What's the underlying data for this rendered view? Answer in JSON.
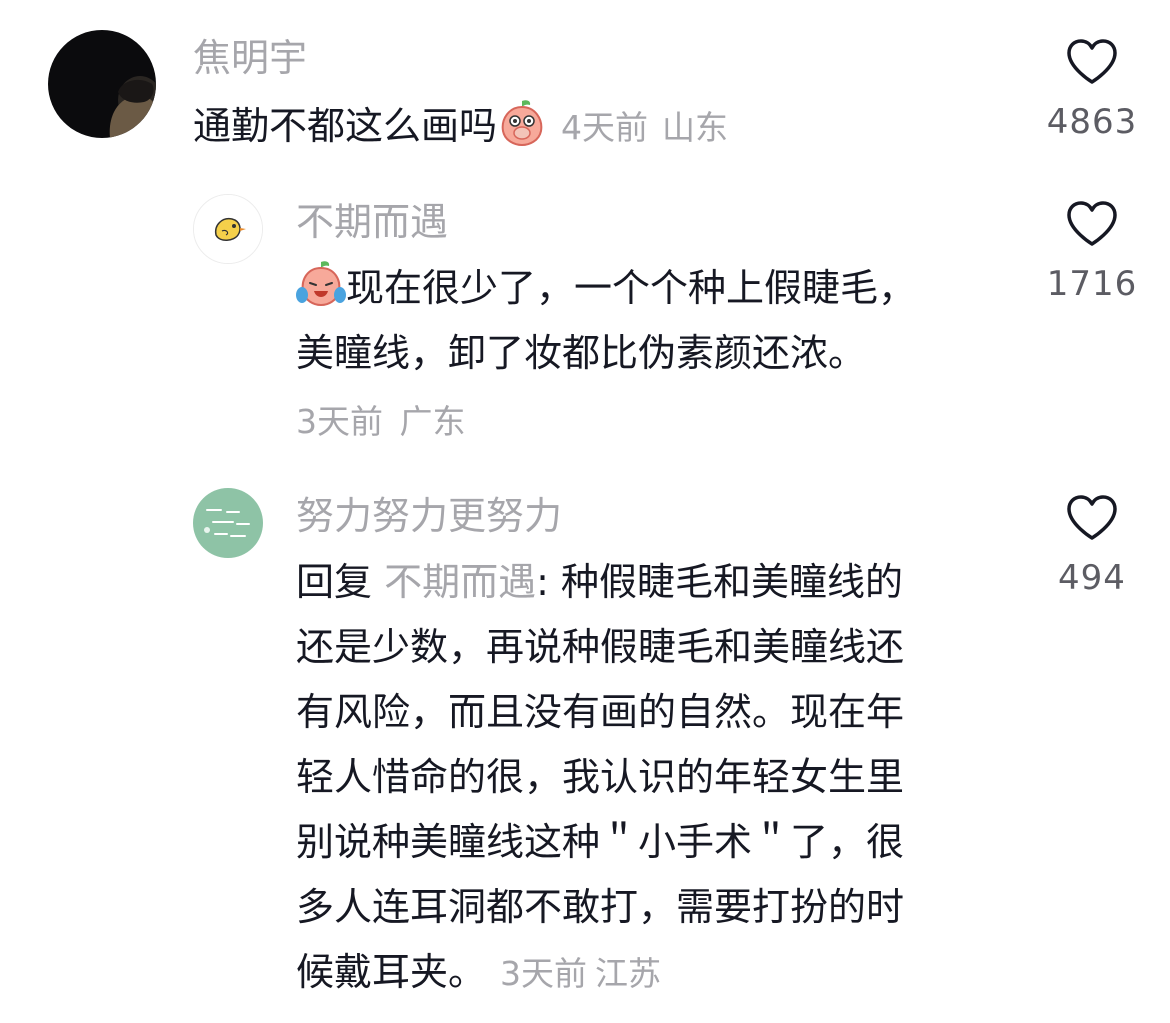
{
  "comments": [
    {
      "username": "焦明宇",
      "text": "通勤不都这么画吗",
      "emoji_icon": "covering-mouth-peach-emoji",
      "time": "4天前",
      "location": "山东",
      "likes": "4863",
      "avatar_icon": "dark-photo-avatar"
    },
    {
      "username": "不期而遇",
      "emoji_icon": "crying-laughing-peach-emoji",
      "text_line1": "现在很少了，一个个种上假睫毛，",
      "text_line2": "美瞳线，卸了妆都比伪素颜还浓。",
      "time": "3天前",
      "location": "广东",
      "likes": "1716",
      "avatar_icon": "yellow-chick-avatar"
    },
    {
      "username": "努力努力更努力",
      "reply_prefix": "回复",
      "reply_target": "不期而遇",
      "reply_colon": ": ",
      "text_line1": "种假睫毛和美瞳线的",
      "text_line2": "还是少数，再说种假睫毛和美瞳线还",
      "text_line3": "有风险，而且没有画的自然。现在年",
      "text_line4": "轻人惜命的很，我认识的年轻女生里",
      "text_line5": "别说种美瞳线这种＂小手术＂了，很",
      "text_line6": "多人连耳洞都不敢打，需要打扮的时",
      "text_line7": "候戴耳夹。",
      "time": "3天前",
      "location": "江苏",
      "likes": "494",
      "avatar_icon": "green-text-avatar"
    }
  ],
  "colors": {
    "username": "#a6a6ab",
    "text": "#161823",
    "meta": "#a6a6ab",
    "like_count": "#5c5c63",
    "heart_stroke": "#161823"
  }
}
